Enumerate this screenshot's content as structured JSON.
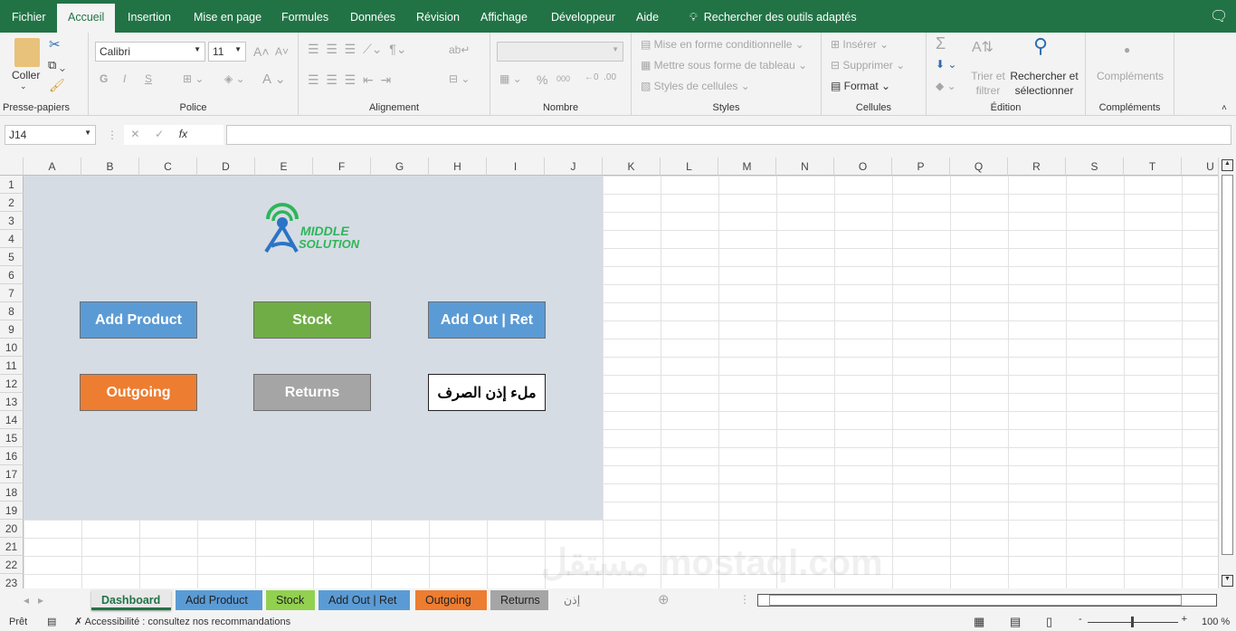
{
  "ribbon_tabs": [
    "Fichier",
    "Accueil",
    "Insertion",
    "Mise en page",
    "Formules",
    "Données",
    "Révision",
    "Affichage",
    "Développeur",
    "Aide"
  ],
  "active_tab": "Accueil",
  "tell_me": "Rechercher des outils adaptés",
  "clipboard": {
    "paste": "Coller",
    "label": "Presse-papiers"
  },
  "font": {
    "name": "Calibri",
    "size": "11",
    "label": "Police",
    "bold": "G",
    "italic": "I",
    "underline": "S"
  },
  "alignment": {
    "label": "Alignement"
  },
  "number": {
    "label": "Nombre",
    "percent": "%",
    "thousands": "000"
  },
  "styles": {
    "conditional": "Mise en forme conditionnelle",
    "table": "Mettre sous forme de tableau",
    "cell_styles": "Styles de cellules",
    "label": "Styles"
  },
  "cells": {
    "insert": "Insérer",
    "delete": "Supprimer",
    "format": "Format",
    "label": "Cellules"
  },
  "editing": {
    "sort": "Trier et filtrer",
    "find": "Rechercher et sélectionner",
    "label": "Édition"
  },
  "addins": {
    "button": "Compléments",
    "label": "Compléments"
  },
  "formula_bar": {
    "name_box": "J14",
    "fx": "fx",
    "value": ""
  },
  "columns": [
    "A",
    "B",
    "C",
    "D",
    "E",
    "F",
    "G",
    "H",
    "I",
    "J",
    "K",
    "L",
    "M",
    "N",
    "O",
    "P",
    "Q",
    "R",
    "S",
    "T",
    "U"
  ],
  "rows": [
    "1",
    "2",
    "3",
    "4",
    "5",
    "6",
    "7",
    "8",
    "9",
    "10",
    "11",
    "12",
    "13",
    "14",
    "15",
    "16",
    "17",
    "18",
    "19",
    "20",
    "21",
    "22",
    "23"
  ],
  "logo": {
    "line1": "MIDDLE",
    "line2": "SOLUTION"
  },
  "dashboard_buttons": [
    {
      "label": "Add Product",
      "color": "#5b9bd5"
    },
    {
      "label": "Stock",
      "color": "#70ad47"
    },
    {
      "label": "Add Out | Ret",
      "color": "#5b9bd5"
    },
    {
      "label": "Outgoing",
      "color": "#ed7d31"
    },
    {
      "label": "Returns",
      "color": "#a5a5a5"
    },
    {
      "label": "ملء إذن الصرف",
      "color": "#ffffff"
    }
  ],
  "sheet_tabs": [
    {
      "label": "Dashboard",
      "color": "#f3f3f3",
      "active": true
    },
    {
      "label": "Add Product",
      "color": "#5b9bd5"
    },
    {
      "label": "Stock",
      "color": "#92d050"
    },
    {
      "label": "Add Out | Ret",
      "color": "#5b9bd5"
    },
    {
      "label": "Outgoing",
      "color": "#ed7d31"
    },
    {
      "label": "Returns",
      "color": "#a5a5a5"
    },
    {
      "label": "إذن الصرف",
      "color": "#f3f3f3"
    }
  ],
  "status": {
    "ready": "Prêt",
    "accessibility": "Accessibilité : consultez nos recommandations",
    "zoom": "100 %"
  },
  "watermark": "مستقل mostaql.com"
}
